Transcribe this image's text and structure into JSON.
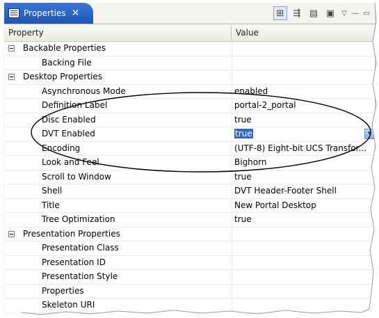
{
  "view": {
    "title": "Properties",
    "close_glyph": "✕"
  },
  "toolbar": {
    "buttons": [
      {
        "icon": "categories-icon",
        "glyph": "⊞"
      },
      {
        "icon": "filter-advanced-icon",
        "glyph": "⇶"
      },
      {
        "icon": "restore-defaults-icon",
        "glyph": "▤"
      },
      {
        "icon": "view-menu-icon",
        "glyph": "▣"
      }
    ],
    "extra": {
      "menu_glyph": "▽",
      "minimize_glyph": "—",
      "maximize_glyph": "▭"
    }
  },
  "table": {
    "columns": [
      "Property",
      "Value"
    ],
    "rows": [
      {
        "type": "group",
        "label": "Backable Properties",
        "value": ""
      },
      {
        "type": "item",
        "label": "Backing File",
        "value": ""
      },
      {
        "type": "group",
        "label": "Desktop Properties",
        "value": ""
      },
      {
        "type": "item",
        "label": "Asynchronous Mode",
        "value": "enabled"
      },
      {
        "type": "item",
        "label": "Definition Label",
        "value": "portal-2_portal"
      },
      {
        "type": "item",
        "label": "Disc Enabled",
        "value": "true"
      },
      {
        "type": "item",
        "label": "DVT Enabled",
        "value": "true",
        "selected": true
      },
      {
        "type": "item",
        "label": "Encoding",
        "value": "(UTF-8) Eight-bit UCS Transfor..."
      },
      {
        "type": "item",
        "label": "Look and Feel",
        "value": "Bighorn"
      },
      {
        "type": "item",
        "label": "Scroll to Window",
        "value": "true"
      },
      {
        "type": "item",
        "label": "Shell",
        "value": "DVT Header-Footer Shell"
      },
      {
        "type": "item",
        "label": "Title",
        "value": "New Portal Desktop"
      },
      {
        "type": "item",
        "label": "Tree Optimization",
        "value": "true"
      },
      {
        "type": "group",
        "label": "Presentation Properties",
        "value": ""
      },
      {
        "type": "item",
        "label": "Presentation Class",
        "value": ""
      },
      {
        "type": "item",
        "label": "Presentation ID",
        "value": ""
      },
      {
        "type": "item",
        "label": "Presentation Style",
        "value": ""
      },
      {
        "type": "item",
        "label": "Properties",
        "value": ""
      },
      {
        "type": "item",
        "label": "Skeleton URI",
        "value": ""
      }
    ]
  },
  "colors": {
    "tab_active": "#2a63c6",
    "selection": "#316ac5",
    "header_bg": "#ebeae4"
  }
}
